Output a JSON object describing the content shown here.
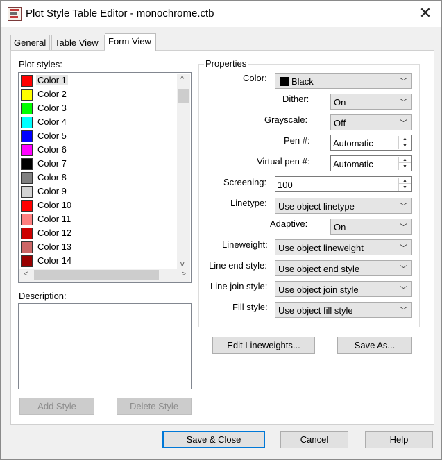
{
  "window": {
    "title": "Plot Style Table Editor - monochrome.ctb",
    "close_glyph": "✕"
  },
  "tabs": [
    {
      "label": "General"
    },
    {
      "label": "Table View"
    },
    {
      "label": "Form View"
    }
  ],
  "plot_styles": {
    "label": "Plot styles:",
    "selected_index": 0,
    "items": [
      {
        "label": "Color 1",
        "color": "#ff0000"
      },
      {
        "label": "Color 2",
        "color": "#ffff00"
      },
      {
        "label": "Color 3",
        "color": "#00ff00"
      },
      {
        "label": "Color 4",
        "color": "#00ffff"
      },
      {
        "label": "Color 5",
        "color": "#0000ff"
      },
      {
        "label": "Color 6",
        "color": "#ff00ff"
      },
      {
        "label": "Color 7",
        "color": "#000000"
      },
      {
        "label": "Color 8",
        "color": "#808080"
      },
      {
        "label": "Color 9",
        "color": "#d3d3d3"
      },
      {
        "label": "Color 10",
        "color": "#ff0000"
      },
      {
        "label": "Color 11",
        "color": "#ff7f7f"
      },
      {
        "label": "Color 12",
        "color": "#cc0000"
      },
      {
        "label": "Color 13",
        "color": "#cc6666"
      },
      {
        "label": "Color 14",
        "color": "#990000"
      }
    ]
  },
  "description": {
    "label": "Description:",
    "value": ""
  },
  "left_buttons": {
    "add_style": "Add Style",
    "delete_style": "Delete Style"
  },
  "properties": {
    "title": "Properties",
    "color": {
      "label": "Color:",
      "value": "Black"
    },
    "dither": {
      "label": "Dither:",
      "value": "On"
    },
    "grayscale": {
      "label": "Grayscale:",
      "value": "Off"
    },
    "pen": {
      "label": "Pen #:",
      "value": "Automatic"
    },
    "virtual_pen": {
      "label": "Virtual pen #:",
      "value": "Automatic"
    },
    "screening": {
      "label": "Screening:",
      "value": "100"
    },
    "linetype": {
      "label": "Linetype:",
      "value": "Use object linetype"
    },
    "adaptive": {
      "label": "Adaptive:",
      "value": "On"
    },
    "lineweight": {
      "label": "Lineweight:",
      "value": "Use object lineweight"
    },
    "line_end_style": {
      "label": "Line end style:",
      "value": "Use object end style"
    },
    "line_join_style": {
      "label": "Line join style:",
      "value": "Use object join style"
    },
    "fill_style": {
      "label": "Fill style:",
      "value": "Use object fill style"
    }
  },
  "prop_buttons": {
    "edit_lineweights": "Edit Lineweights...",
    "save_as": "Save As..."
  },
  "footer": {
    "save_close": "Save & Close",
    "cancel": "Cancel",
    "help": "Help"
  },
  "icons": {
    "chevron_down": "﹀",
    "scroll_up": "^",
    "scroll_down": "v",
    "scroll_left": "<",
    "scroll_right": ">"
  }
}
